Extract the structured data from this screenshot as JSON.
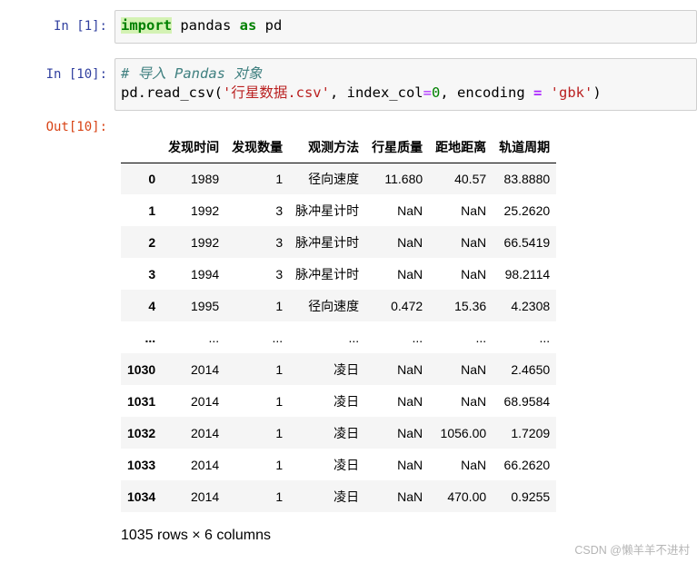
{
  "cells": [
    {
      "prompt": "In  [1]:",
      "code": {
        "kw1": "import",
        "mid": " pandas ",
        "kw2": "as",
        "end": " pd"
      }
    },
    {
      "prompt": "In  [10]:",
      "comment": "# 导入 Pandas 对象",
      "code": {
        "fn": "pd.read_csv(",
        "str1": "'行星数据.csv'",
        "a": ", index_col",
        "eq1": "=",
        "num": "0",
        "b": ", encoding ",
        "eq2": "=",
        "c": " ",
        "str2": "'gbk'",
        "close": ")"
      }
    }
  ],
  "output": {
    "prompt": "Out[10]:",
    "columns": [
      "",
      "发现时间",
      "发现数量",
      "观测方法",
      "行星质量",
      "距地距离",
      "轨道周期"
    ],
    "rows": [
      [
        "0",
        "1989",
        "1",
        "径向速度",
        "11.680",
        "40.57",
        "83.8880"
      ],
      [
        "1",
        "1992",
        "3",
        "脉冲星计时",
        "NaN",
        "NaN",
        "25.2620"
      ],
      [
        "2",
        "1992",
        "3",
        "脉冲星计时",
        "NaN",
        "NaN",
        "66.5419"
      ],
      [
        "3",
        "1994",
        "3",
        "脉冲星计时",
        "NaN",
        "NaN",
        "98.2114"
      ],
      [
        "4",
        "1995",
        "1",
        "径向速度",
        "0.472",
        "15.36",
        "4.2308"
      ],
      [
        "...",
        "...",
        "...",
        "...",
        "...",
        "...",
        "..."
      ],
      [
        "1030",
        "2014",
        "1",
        "凌日",
        "NaN",
        "NaN",
        "2.4650"
      ],
      [
        "1031",
        "2014",
        "1",
        "凌日",
        "NaN",
        "NaN",
        "68.9584"
      ],
      [
        "1032",
        "2014",
        "1",
        "凌日",
        "NaN",
        "1056.00",
        "1.7209"
      ],
      [
        "1033",
        "2014",
        "1",
        "凌日",
        "NaN",
        "NaN",
        "66.2620"
      ],
      [
        "1034",
        "2014",
        "1",
        "凌日",
        "NaN",
        "470.00",
        "0.9255"
      ]
    ],
    "footer": "1035 rows × 6 columns"
  },
  "watermark": "CSDN @懒羊羊不进村"
}
